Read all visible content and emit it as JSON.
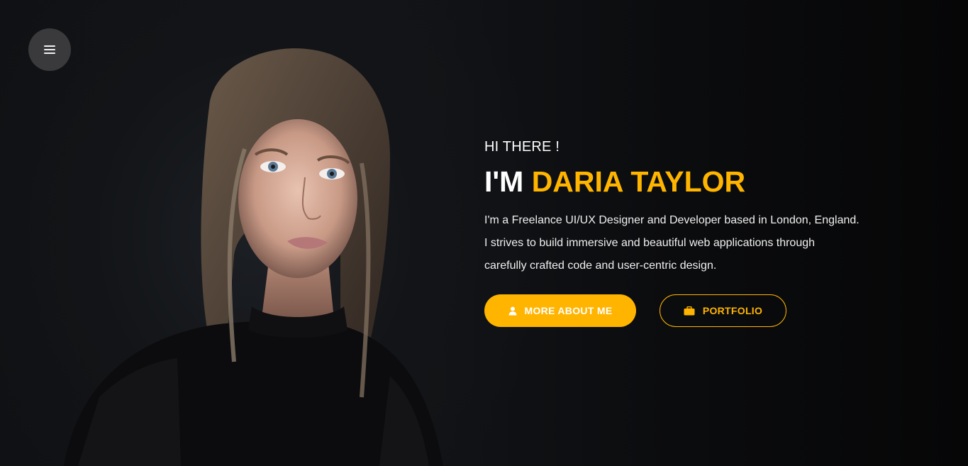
{
  "menu": {
    "icon": "hamburger-icon"
  },
  "hero": {
    "greeting": "HI THERE !",
    "headline_prefix": "I'M ",
    "headline_name": "DARIA TAYLOR",
    "bio_lines": [
      "I'm a Freelance UI/UX Designer and Developer based in London, England.",
      "I strives to build immersive and beautiful web applications through",
      "carefully crafted code and user-centric design."
    ]
  },
  "buttons": {
    "more_about": {
      "label": "MORE ABOUT ME",
      "icon": "user-icon"
    },
    "portfolio": {
      "label": "PORTFOLIO",
      "icon": "briefcase-icon"
    }
  },
  "colors": {
    "accent": "#ffb400",
    "background": "#0b0b0d",
    "menu_button": "#3a3a3c",
    "text": "#ffffff"
  }
}
